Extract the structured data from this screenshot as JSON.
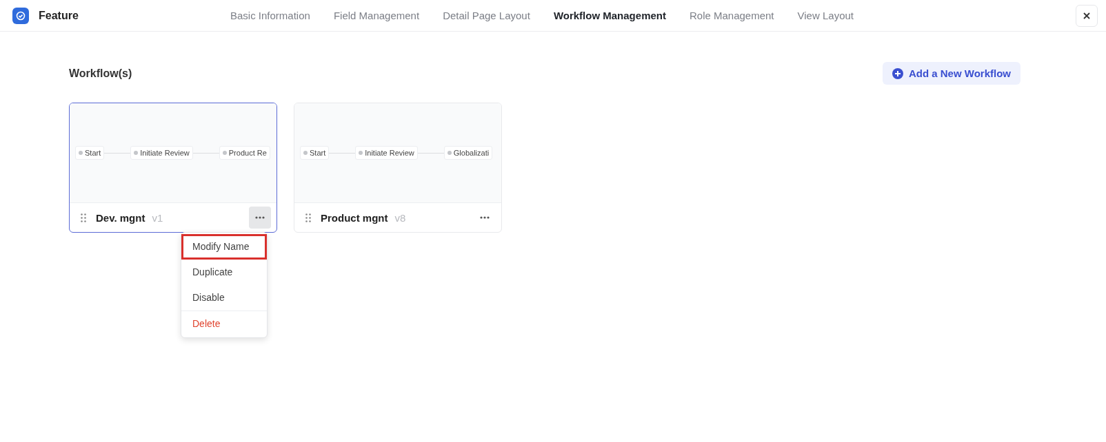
{
  "header": {
    "title": "Feature"
  },
  "tabs": [
    {
      "label": "Basic Information",
      "selected": false
    },
    {
      "label": "Field Management",
      "selected": false
    },
    {
      "label": "Detail Page Layout",
      "selected": false
    },
    {
      "label": "Workflow Management",
      "selected": true
    },
    {
      "label": "Role Management",
      "selected": false
    },
    {
      "label": "View Layout",
      "selected": false
    }
  ],
  "section": {
    "title": "Workflow(s)",
    "add_button": "Add a New Workflow"
  },
  "workflows": [
    {
      "name": "Dev. mgnt",
      "version": "v1",
      "selected": true,
      "steps": [
        "Start",
        "Initiate Review",
        "Product Re"
      ]
    },
    {
      "name": "Product mgnt",
      "version": "v8",
      "selected": false,
      "steps": [
        "Start",
        "Initiate Review",
        "Globalizati"
      ]
    }
  ],
  "menu": {
    "items": [
      {
        "label": "Modify Name",
        "kind": "normal",
        "highlighted": true
      },
      {
        "label": "Duplicate",
        "kind": "normal",
        "highlighted": false
      },
      {
        "label": "Disable",
        "kind": "normal",
        "highlighted": false
      },
      {
        "label": "Delete",
        "kind": "danger",
        "highlighted": false
      }
    ]
  }
}
